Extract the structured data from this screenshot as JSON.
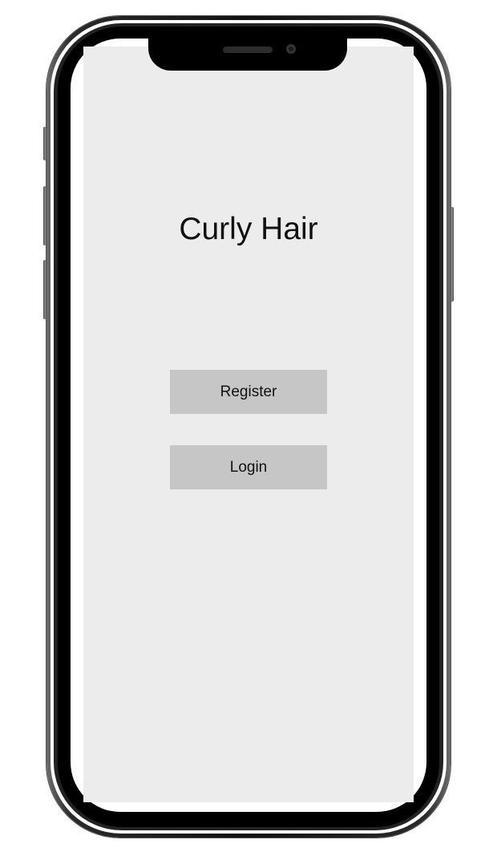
{
  "app": {
    "title": "Curly Hair"
  },
  "buttons": {
    "register_label": "Register",
    "login_label": "Login"
  },
  "colors": {
    "screen_background": "#ececec",
    "button_background": "#c6c6c6",
    "text": "#111111"
  }
}
